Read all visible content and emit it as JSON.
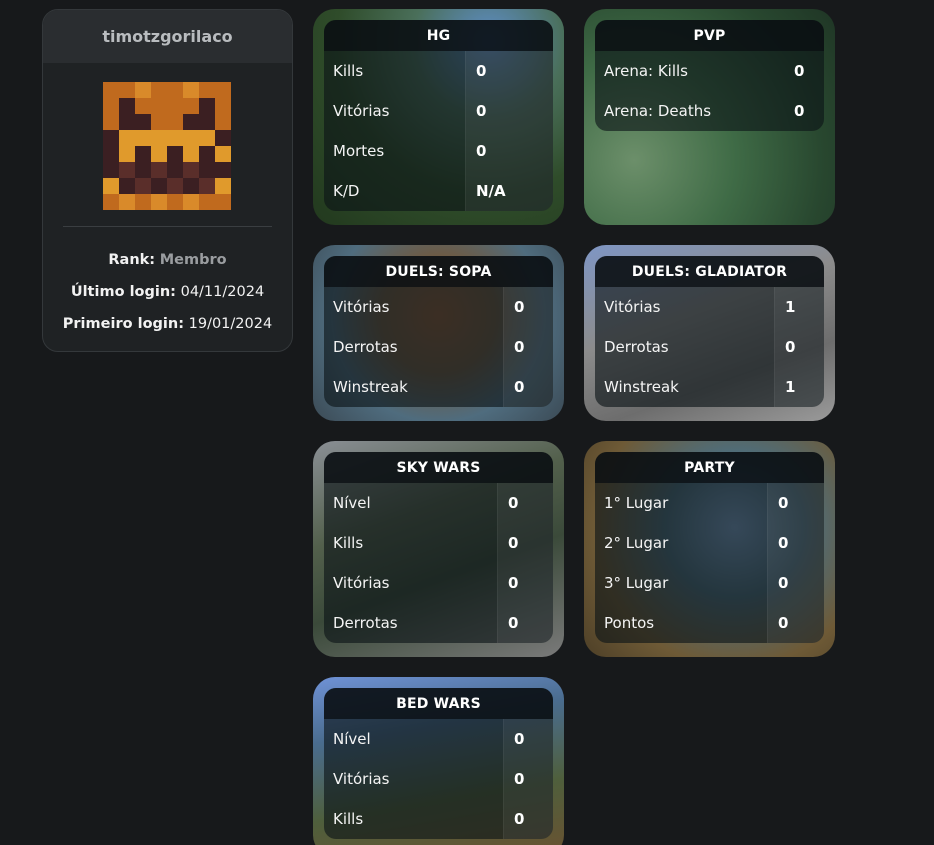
{
  "profile": {
    "username": "timotzgorilaco",
    "rank_label": "Rank:",
    "rank_value": "Membro",
    "last_login_label": "Último login:",
    "last_login_value": "04/11/2024",
    "first_login_label": "Primeiro login:",
    "first_login_value": "19/01/2024"
  },
  "cards": {
    "hg": {
      "title": "HG",
      "rows": [
        {
          "label": "Kills",
          "value": "0"
        },
        {
          "label": "Vitórias",
          "value": "0"
        },
        {
          "label": "Mortes",
          "value": "0"
        },
        {
          "label": "K/D",
          "value": "N/A"
        }
      ]
    },
    "pvp": {
      "title": "PVP",
      "rows": [
        {
          "label": "Arena: Kills",
          "value": "0"
        },
        {
          "label": "Arena: Deaths",
          "value": "0"
        }
      ]
    },
    "duels_sopa": {
      "title": "DUELS: SOPA",
      "rows": [
        {
          "label": "Vitórias",
          "value": "0"
        },
        {
          "label": "Derrotas",
          "value": "0"
        },
        {
          "label": "Winstreak",
          "value": "0"
        }
      ]
    },
    "duels_gladiator": {
      "title": "DUELS: GLADIATOR",
      "rows": [
        {
          "label": "Vitórias",
          "value": "1"
        },
        {
          "label": "Derrotas",
          "value": "0"
        },
        {
          "label": "Winstreak",
          "value": "1"
        }
      ]
    },
    "sky_wars": {
      "title": "SKY WARS",
      "rows": [
        {
          "label": "Nível",
          "value": "0"
        },
        {
          "label": "Kills",
          "value": "0"
        },
        {
          "label": "Vitórias",
          "value": "0"
        },
        {
          "label": "Derrotas",
          "value": "0"
        }
      ]
    },
    "party": {
      "title": "PARTY",
      "rows": [
        {
          "label": "1° Lugar",
          "value": "0"
        },
        {
          "label": "2° Lugar",
          "value": "0"
        },
        {
          "label": "3° Lugar",
          "value": "0"
        },
        {
          "label": "Pontos",
          "value": "0"
        }
      ]
    },
    "bed_wars": {
      "title": "BED WARS",
      "rows": [
        {
          "label": "Nível",
          "value": "0"
        },
        {
          "label": "Vitórias",
          "value": "0"
        },
        {
          "label": "Kills",
          "value": "0"
        }
      ]
    }
  }
}
